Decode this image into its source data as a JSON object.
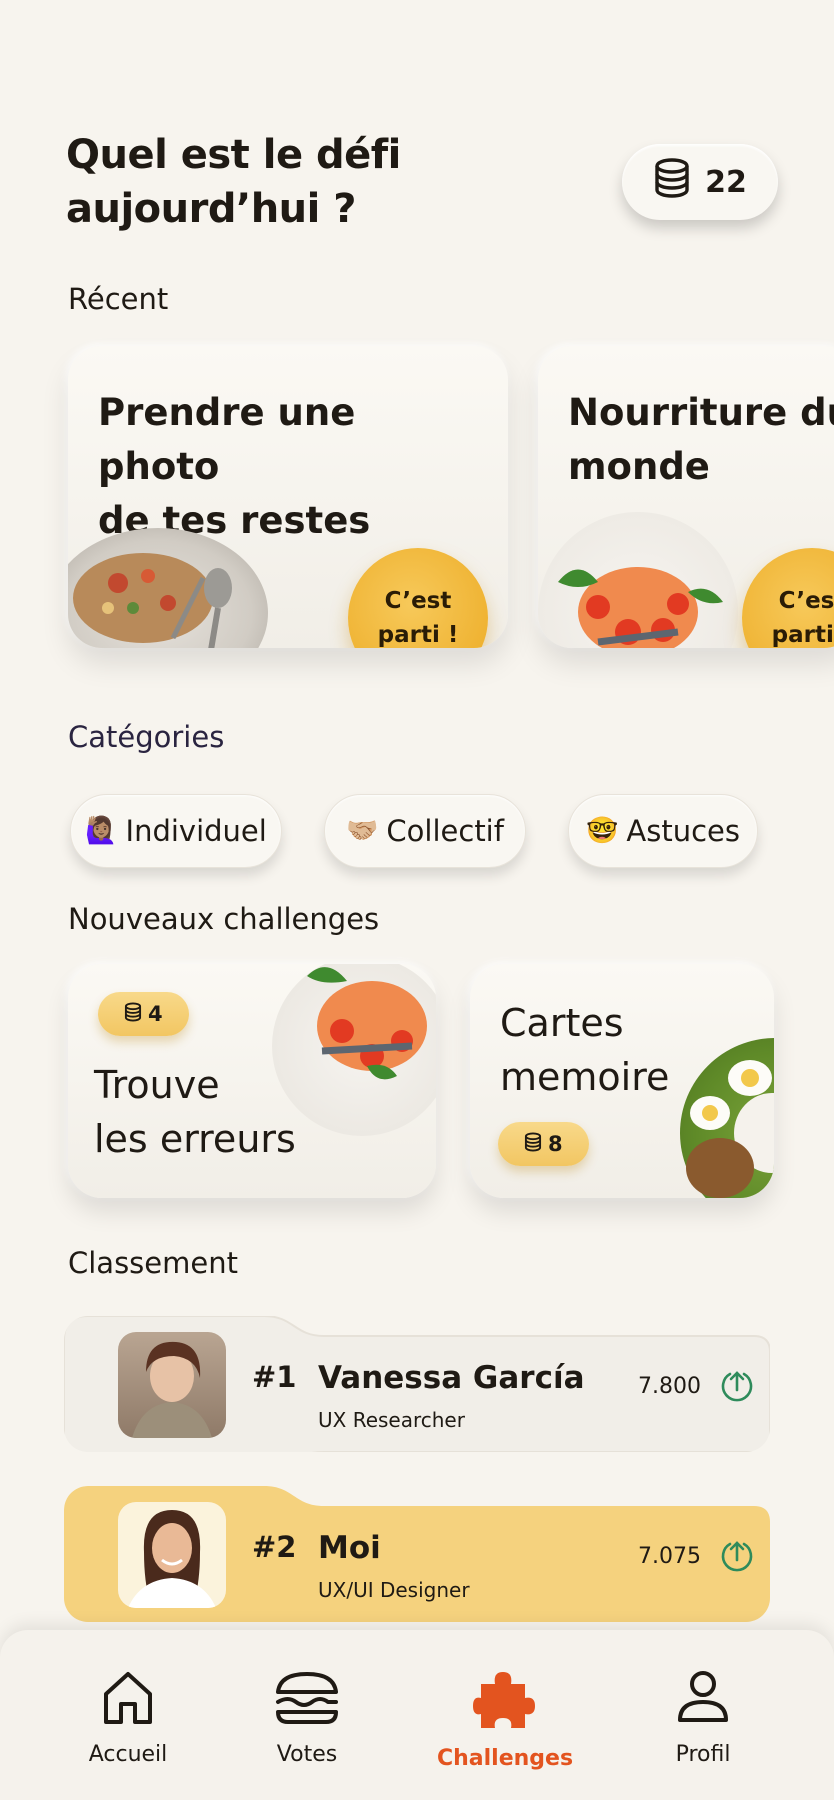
{
  "header": {
    "title_line1": "Quel est le défi",
    "title_line2": "aujourd’hui ?",
    "coins": "22"
  },
  "sections": {
    "recent": "Récent",
    "categories": "Catégories",
    "new_challenges": "Nouveaux challenges",
    "ranking": "Classement"
  },
  "recent": [
    {
      "title_line1": "Prendre une photo",
      "title_line2": "de tes restes",
      "cta_line1": "C’est",
      "cta_line2": "parti !"
    },
    {
      "title_line1": "Nourriture du",
      "title_line2": "monde",
      "cta_line1": "C’est",
      "cta_line2": "parti !"
    }
  ],
  "categories": [
    {
      "emoji": "🙋🏽‍♀️",
      "label": "Individuel"
    },
    {
      "emoji": "🤝🏼",
      "label": "Collectif"
    },
    {
      "emoji": "🤓",
      "label": "Astuces"
    }
  ],
  "new_challenges": [
    {
      "coins": "4",
      "title_line1": "Trouve",
      "title_line2": "les erreurs"
    },
    {
      "coins": "8",
      "title_line1": "Cartes",
      "title_line2": "memoire"
    }
  ],
  "ranking": [
    {
      "rank": "#1",
      "name": "Vanessa García",
      "role": "UX Researcher",
      "score": "7.800"
    },
    {
      "rank": "#2",
      "name": "Moi",
      "role": "UX/UI Designer",
      "score": "7.075"
    }
  ],
  "nav": [
    {
      "label": "Accueil",
      "icon": "home-icon"
    },
    {
      "label": "Votes",
      "icon": "burger-icon"
    },
    {
      "label": "Challenges",
      "icon": "puzzle-icon",
      "active": true
    },
    {
      "label": "Profil",
      "icon": "user-icon"
    }
  ],
  "colors": {
    "background": "#f7f4ee",
    "accent_yellow": "#efb333",
    "active_nav": "#e3541f",
    "up_arrow": "#2e8b5b",
    "highlight_row": "#f5d27e"
  }
}
